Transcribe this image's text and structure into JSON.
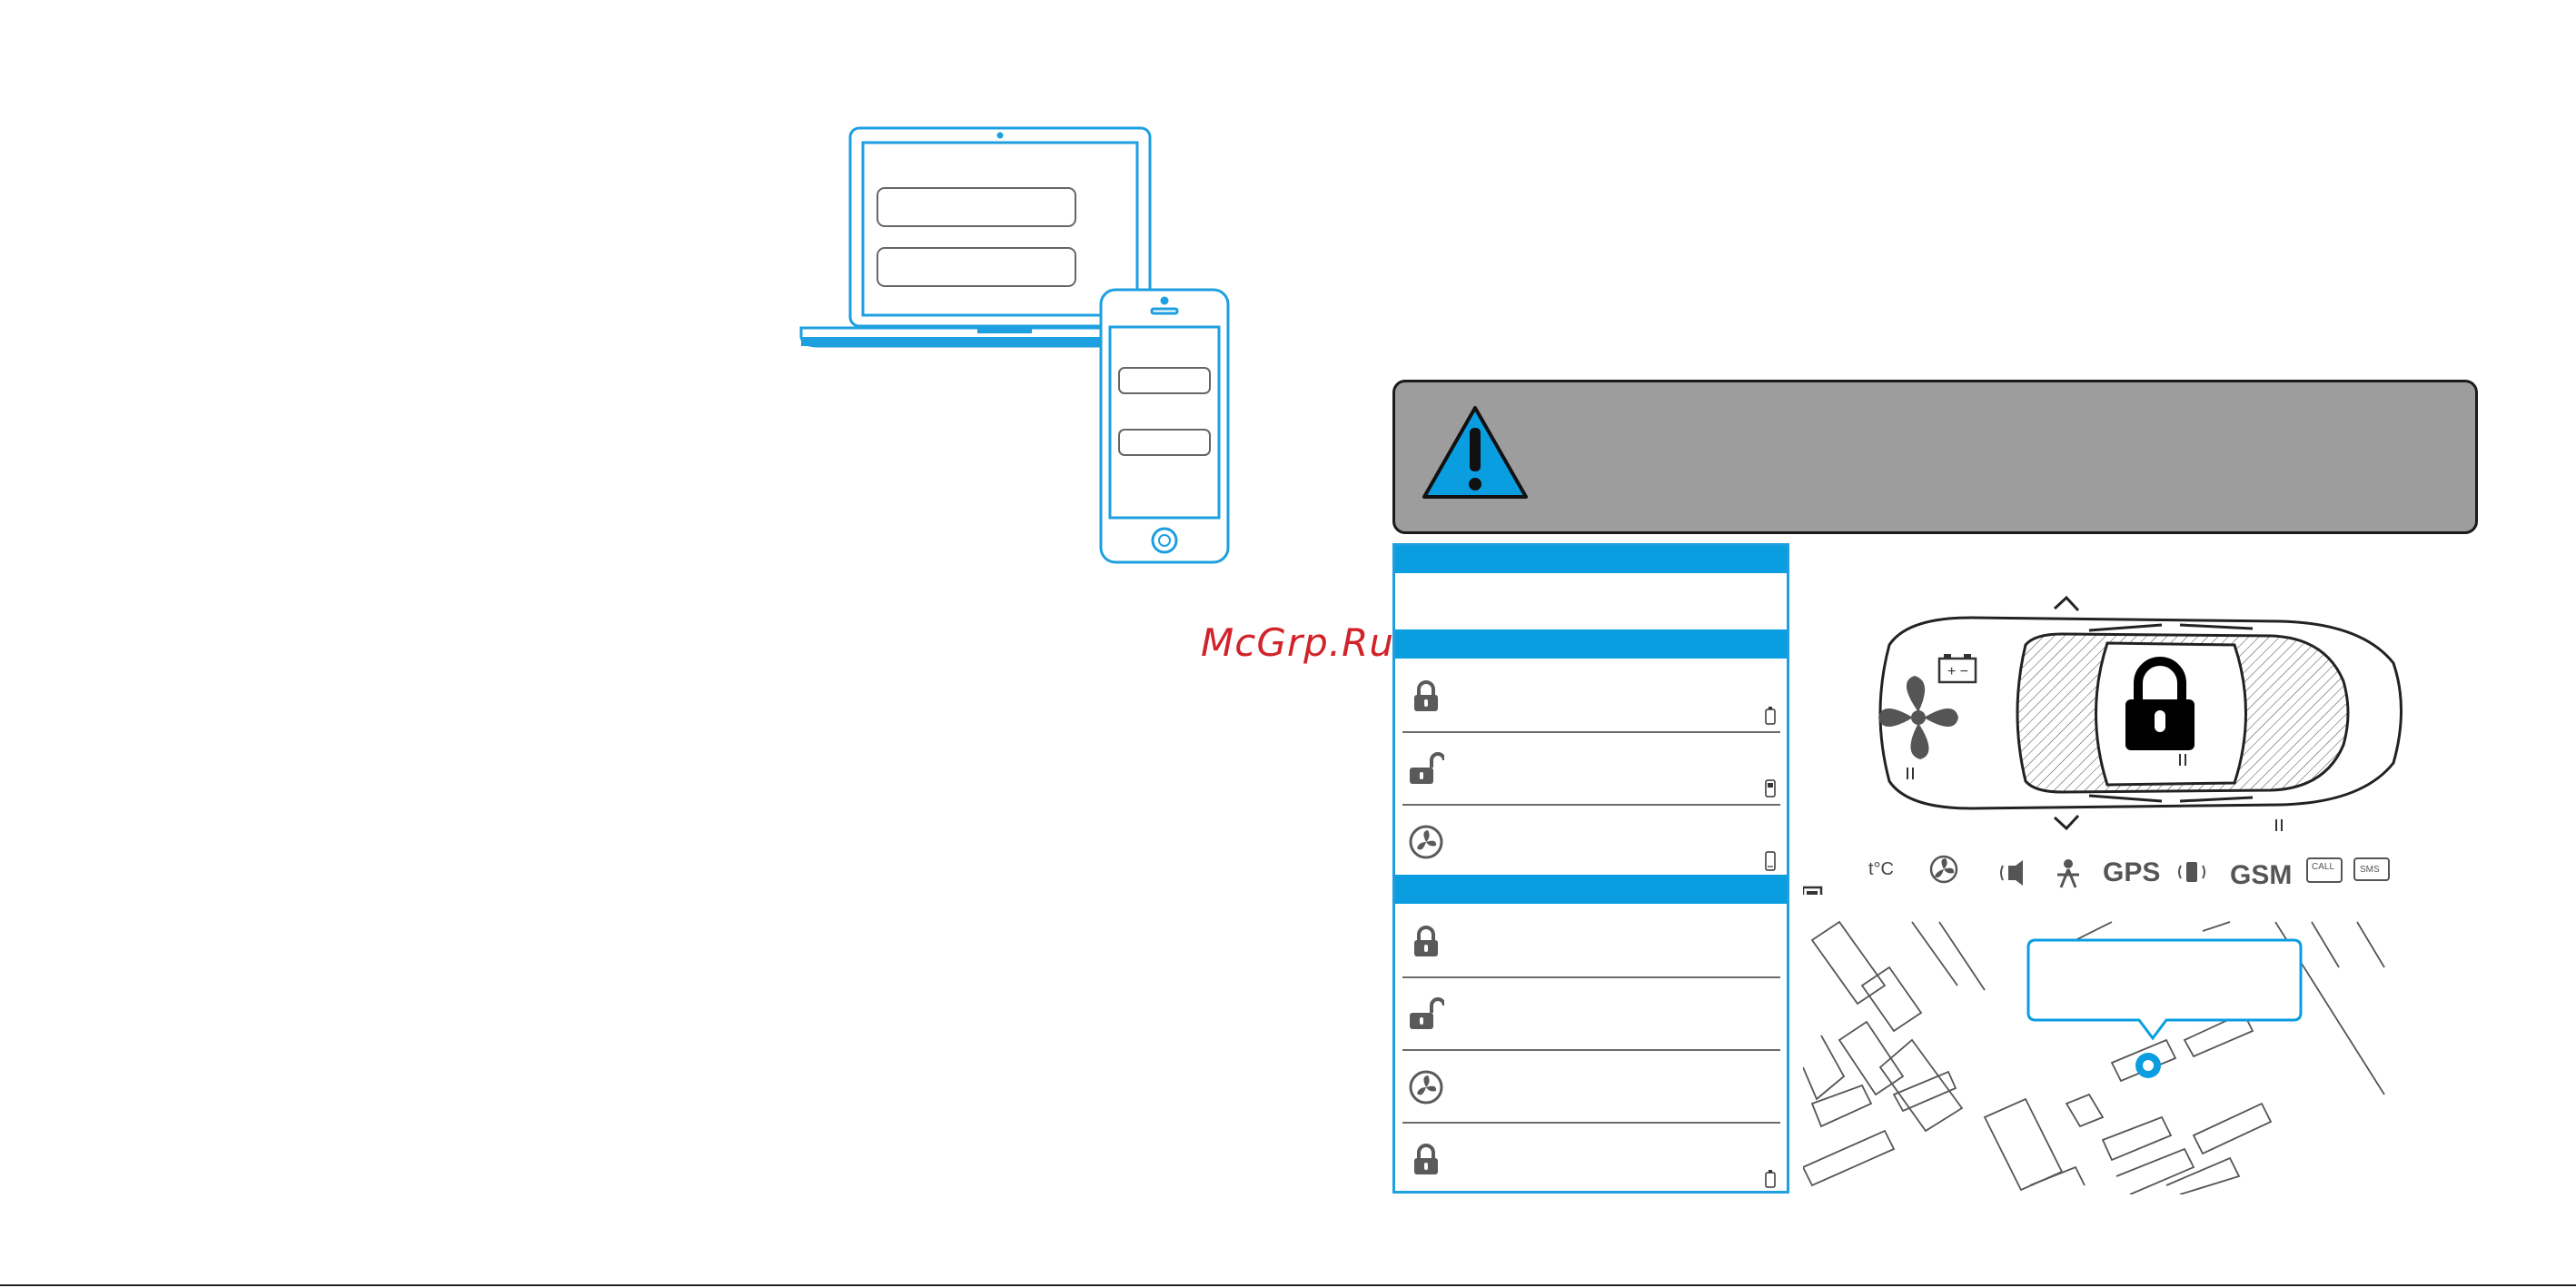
{
  "watermark": "McGrp.Ru",
  "status_icons": {
    "gps_label": "GPS",
    "gsm_label": "GSM",
    "call_label": "CALL",
    "sms_label": "SMS",
    "temp_label": "t°C"
  },
  "colors": {
    "accent": "#0a9ee0",
    "warning_bg": "#9d9d9d",
    "watermark": "#d0232a",
    "icon_gray": "#5a5a5a"
  },
  "panel": {
    "section1_rows": [
      {
        "icon": "lock-closed-icon",
        "device": "key-fob-icon"
      },
      {
        "icon": "lock-open-icon",
        "device": "remote-icon"
      },
      {
        "icon": "engine-fan-icon",
        "device": "phone-icon"
      }
    ],
    "section2_rows": [
      {
        "icon": "lock-closed-icon"
      },
      {
        "icon": "lock-open-icon"
      },
      {
        "icon": "engine-fan-icon"
      },
      {
        "icon": "lock-closed-icon",
        "device": "key-fob-icon"
      }
    ]
  }
}
